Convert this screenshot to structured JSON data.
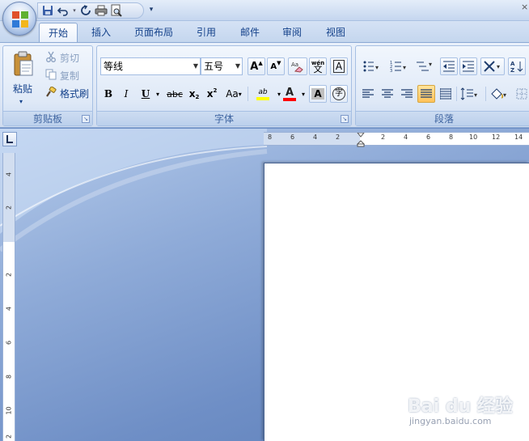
{
  "quick_access": {
    "items": [
      {
        "name": "save-icon"
      },
      {
        "name": "undo-icon"
      },
      {
        "name": "redo-icon"
      },
      {
        "name": "print-icon"
      },
      {
        "name": "print-preview-icon"
      }
    ],
    "more": "▾"
  },
  "window": {
    "close": "×"
  },
  "tabs": [
    {
      "label": "开始",
      "active": true
    },
    {
      "label": "插入"
    },
    {
      "label": "页面布局"
    },
    {
      "label": "引用"
    },
    {
      "label": "邮件"
    },
    {
      "label": "审阅"
    },
    {
      "label": "视图"
    }
  ],
  "ribbon": {
    "clipboard": {
      "paste": "粘贴",
      "cut": "剪切",
      "copy": "复制",
      "format_painter": "格式刷",
      "group_label": "剪贴板"
    },
    "font": {
      "font_name": "等线",
      "font_size": "五号",
      "grow": "A",
      "shrink": "A",
      "phonetic": "wén",
      "phonetic_char": "文",
      "border_char": "A",
      "bold": "B",
      "italic": "I",
      "underline": "U",
      "strike": "abc",
      "subscript": "x",
      "superscript": "x",
      "change_case": "Aa",
      "highlight": "ab",
      "font_color": "A",
      "shading": "A",
      "enclose": "字",
      "group_label": "字体"
    },
    "paragraph": {
      "group_label": "段落"
    }
  },
  "colors": {
    "highlight": "#ffff00",
    "font_color": "#ff0000",
    "accent": "#15428b"
  },
  "ruler": {
    "h_labels": [
      "8",
      "6",
      "4",
      "2",
      "2",
      "4",
      "6",
      "8",
      "10",
      "12",
      "14"
    ],
    "v_labels": [
      "4",
      "2",
      "2",
      "4",
      "6",
      "8",
      "10",
      "2"
    ]
  },
  "watermark": {
    "text": "Bai du 经验",
    "url": "jingyan.baidu.com"
  }
}
